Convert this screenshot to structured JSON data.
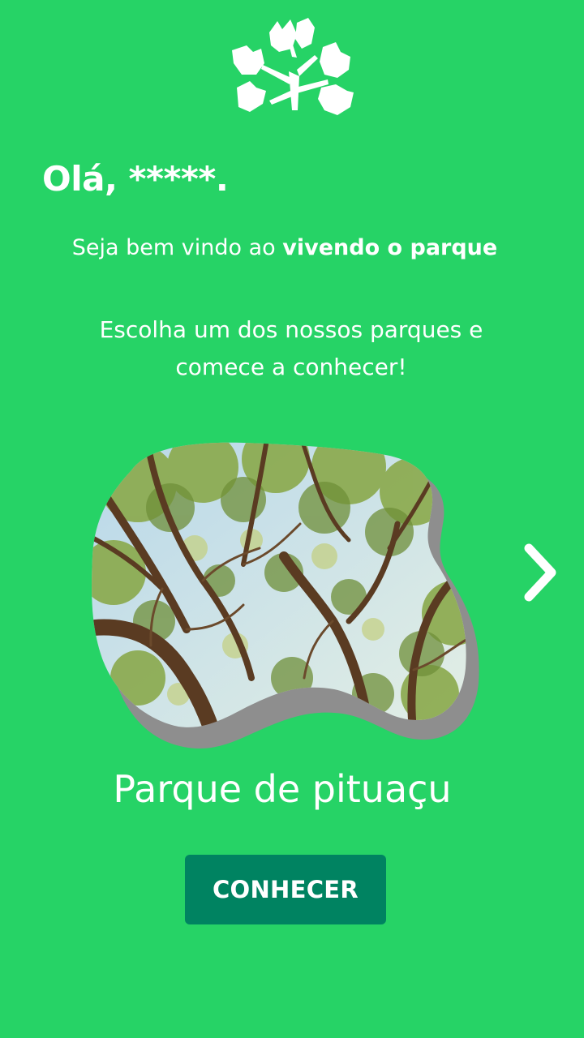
{
  "colors": {
    "background": "#26d366",
    "button": "#008361",
    "shadow": "#8e8e8e",
    "text": "#ffffff"
  },
  "header": {
    "logo_icon": "tree-leaves-logo-icon"
  },
  "greeting": {
    "text": "Olá, *****."
  },
  "welcome": {
    "prefix": "Seja bem vindo ao ",
    "app_name": "vivendo o parque"
  },
  "instructions": {
    "line1": "Escolha um dos nossos parques e",
    "line2": "comece a conhecer!"
  },
  "carousel": {
    "current_park": {
      "name": "Parque de pituaçu",
      "image_icon": "tree-canopy-photo"
    },
    "next_icon": "chevron-right-icon"
  },
  "action": {
    "button_label": "CONHECER"
  }
}
